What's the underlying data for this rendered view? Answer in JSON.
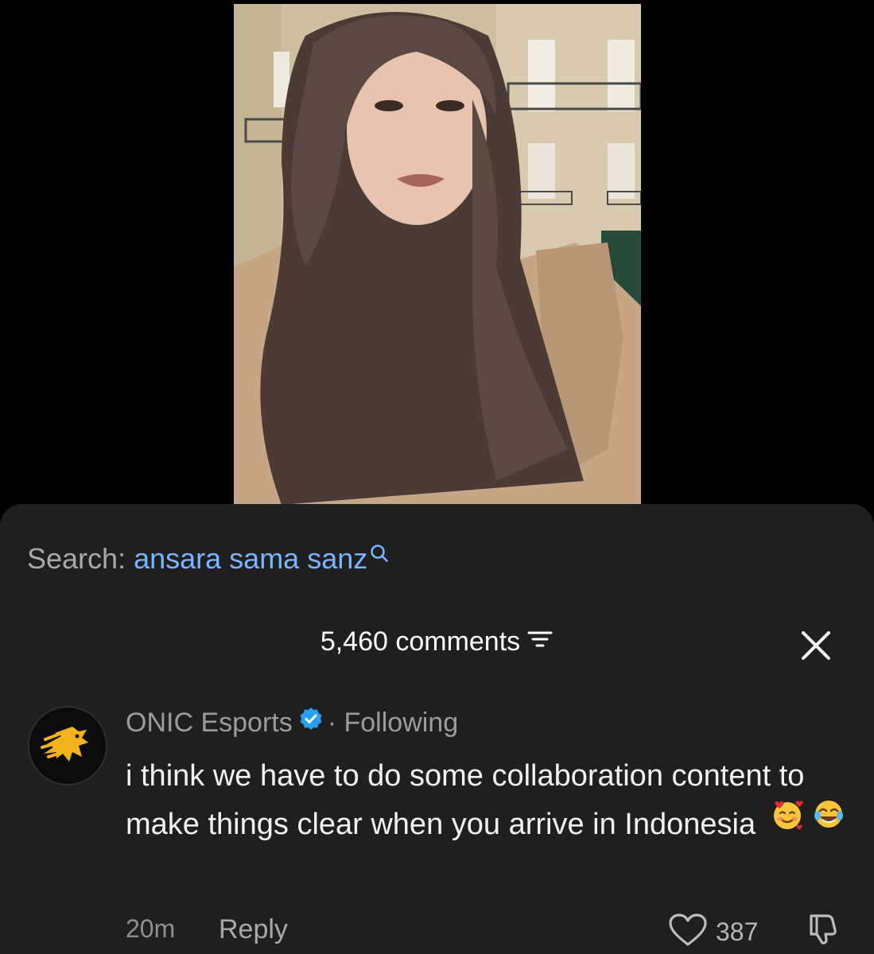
{
  "search": {
    "prefix": "Search:",
    "term": "ansara sama sanz"
  },
  "comments_panel": {
    "count_label": "5,460 comments"
  },
  "comment": {
    "author": "ONIC Esports",
    "separator": "·",
    "follow_status": "Following",
    "text": "i think we have to do some collaboration content to make things clear when you arrive in Indonesia",
    "time": "20m",
    "reply_label": "Reply",
    "like_count": "387"
  },
  "icons": {
    "search": "search-icon",
    "filter": "filter-icon",
    "close": "close-icon",
    "verified": "verified-icon",
    "heart": "heart-icon",
    "dislike": "dislike-icon"
  },
  "colors": {
    "sheet_bg": "#1f1f1f",
    "link_blue": "#79b4ff",
    "verified_blue": "#27a0f0",
    "avatar_logo": "#f4b31a"
  }
}
